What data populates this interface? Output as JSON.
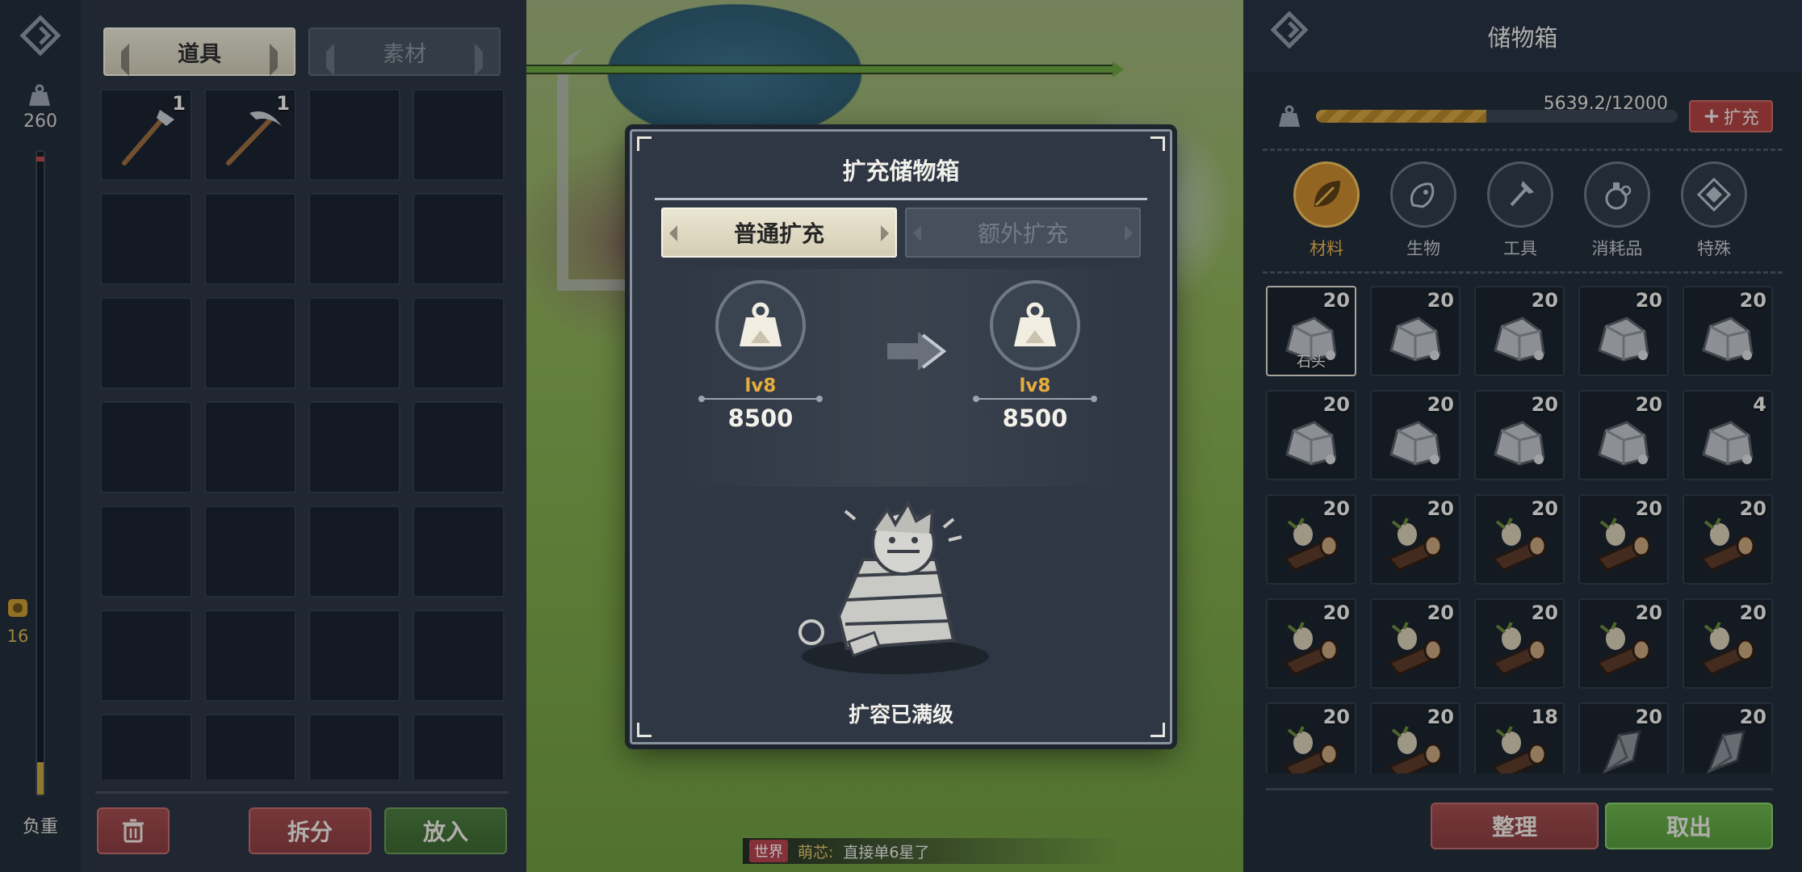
{
  "left_panel": {
    "capacity_value": "260",
    "coin_value": "16",
    "load_label": "负重",
    "load_fill_fraction": 0.05,
    "tabs": [
      {
        "label": "道具",
        "active": true
      },
      {
        "label": "素材",
        "active": false
      }
    ],
    "slots": [
      {
        "item": "axe-icon",
        "qty": "1"
      },
      {
        "item": "pickaxe-icon",
        "qty": "1"
      },
      {},
      {},
      {},
      {},
      {},
      {},
      {},
      {},
      {},
      {},
      {},
      {},
      {},
      {},
      {},
      {},
      {},
      {},
      {},
      {},
      {},
      {},
      {},
      {},
      {},
      {}
    ],
    "buttons": {
      "delete_icon": "trash-icon",
      "split_label": "拆分",
      "put_in_label": "放入"
    }
  },
  "storage_panel": {
    "title": "储物箱",
    "capacity_text": "5639.2/12000",
    "capacity_used": 5639.2,
    "capacity_max": 12000,
    "expand_label": "扩充",
    "categories": [
      {
        "label": "材料",
        "icon": "leaf-icon",
        "active": true
      },
      {
        "label": "生物",
        "icon": "creature-icon",
        "active": false
      },
      {
        "label": "工具",
        "icon": "tool-icon",
        "active": false
      },
      {
        "label": "消耗品",
        "icon": "potion-icon",
        "active": false
      },
      {
        "label": "特殊",
        "icon": "special-icon",
        "active": false
      }
    ],
    "items": [
      {
        "kind": "stone",
        "qty": "20",
        "name": "石头",
        "selected": true
      },
      {
        "kind": "stone",
        "qty": "20"
      },
      {
        "kind": "stone",
        "qty": "20"
      },
      {
        "kind": "stone",
        "qty": "20"
      },
      {
        "kind": "stone",
        "qty": "20"
      },
      {
        "kind": "stone",
        "qty": "20"
      },
      {
        "kind": "stone",
        "qty": "20"
      },
      {
        "kind": "stone",
        "qty": "20"
      },
      {
        "kind": "stone",
        "qty": "20"
      },
      {
        "kind": "stone",
        "qty": "4"
      },
      {
        "kind": "log",
        "qty": "20"
      },
      {
        "kind": "log",
        "qty": "20"
      },
      {
        "kind": "log",
        "qty": "20"
      },
      {
        "kind": "log",
        "qty": "20"
      },
      {
        "kind": "log",
        "qty": "20"
      },
      {
        "kind": "log",
        "qty": "20"
      },
      {
        "kind": "log",
        "qty": "20"
      },
      {
        "kind": "log",
        "qty": "20"
      },
      {
        "kind": "log",
        "qty": "20"
      },
      {
        "kind": "log",
        "qty": "20"
      },
      {
        "kind": "log",
        "qty": "20"
      },
      {
        "kind": "log",
        "qty": "20"
      },
      {
        "kind": "log",
        "qty": "18"
      },
      {
        "kind": "flint",
        "qty": "20"
      },
      {
        "kind": "flint",
        "qty": "20"
      }
    ],
    "buttons": {
      "sort_label": "整理",
      "take_out_label": "取出"
    }
  },
  "modal": {
    "title": "扩充储物箱",
    "tabs": [
      {
        "label": "普通扩充",
        "active": true
      },
      {
        "label": "额外扩充",
        "active": false
      }
    ],
    "from": {
      "level": "lv8",
      "value": "8500"
    },
    "to": {
      "level": "lv8",
      "value": "8500"
    },
    "status": "扩容已满级"
  },
  "chat": {
    "channel": "世界",
    "sender": "萌芯:",
    "message": "直接单6星了"
  }
}
